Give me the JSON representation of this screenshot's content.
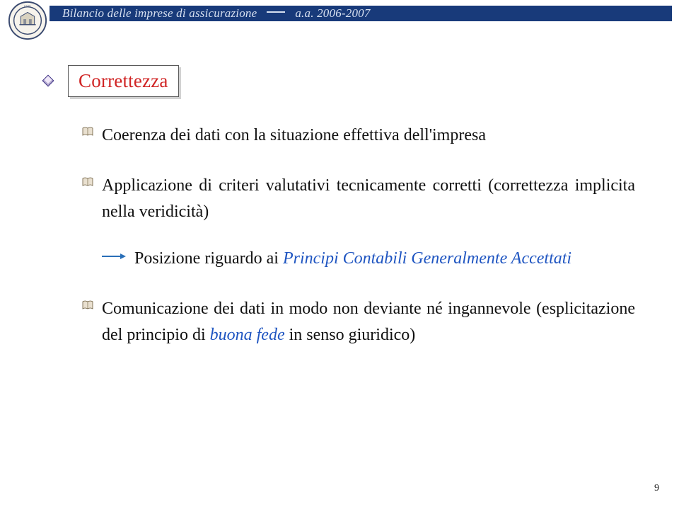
{
  "header": {
    "course": "Bilancio delle imprese di assicurazione",
    "year": "a.a. 2006-2007"
  },
  "title": "Correttezza",
  "items": [
    {
      "text": "Coerenza dei dati con la situazione effettiva dell'impresa"
    },
    {
      "text": "Applicazione di criteri valutativi tecnicamente corretti (correttezza implicita nella veridicità)",
      "sub": {
        "prefix": "Posizione riguardo ai ",
        "emph": "Principi Contabili Generalmente Accettati"
      }
    },
    {
      "text_prefix": "Comunicazione dei dati in modo non deviante né ingannevole (esplicitazione del principio di ",
      "emph": "buona fede",
      "text_suffix": " in senso giuridico)"
    }
  ],
  "page_number": "9"
}
